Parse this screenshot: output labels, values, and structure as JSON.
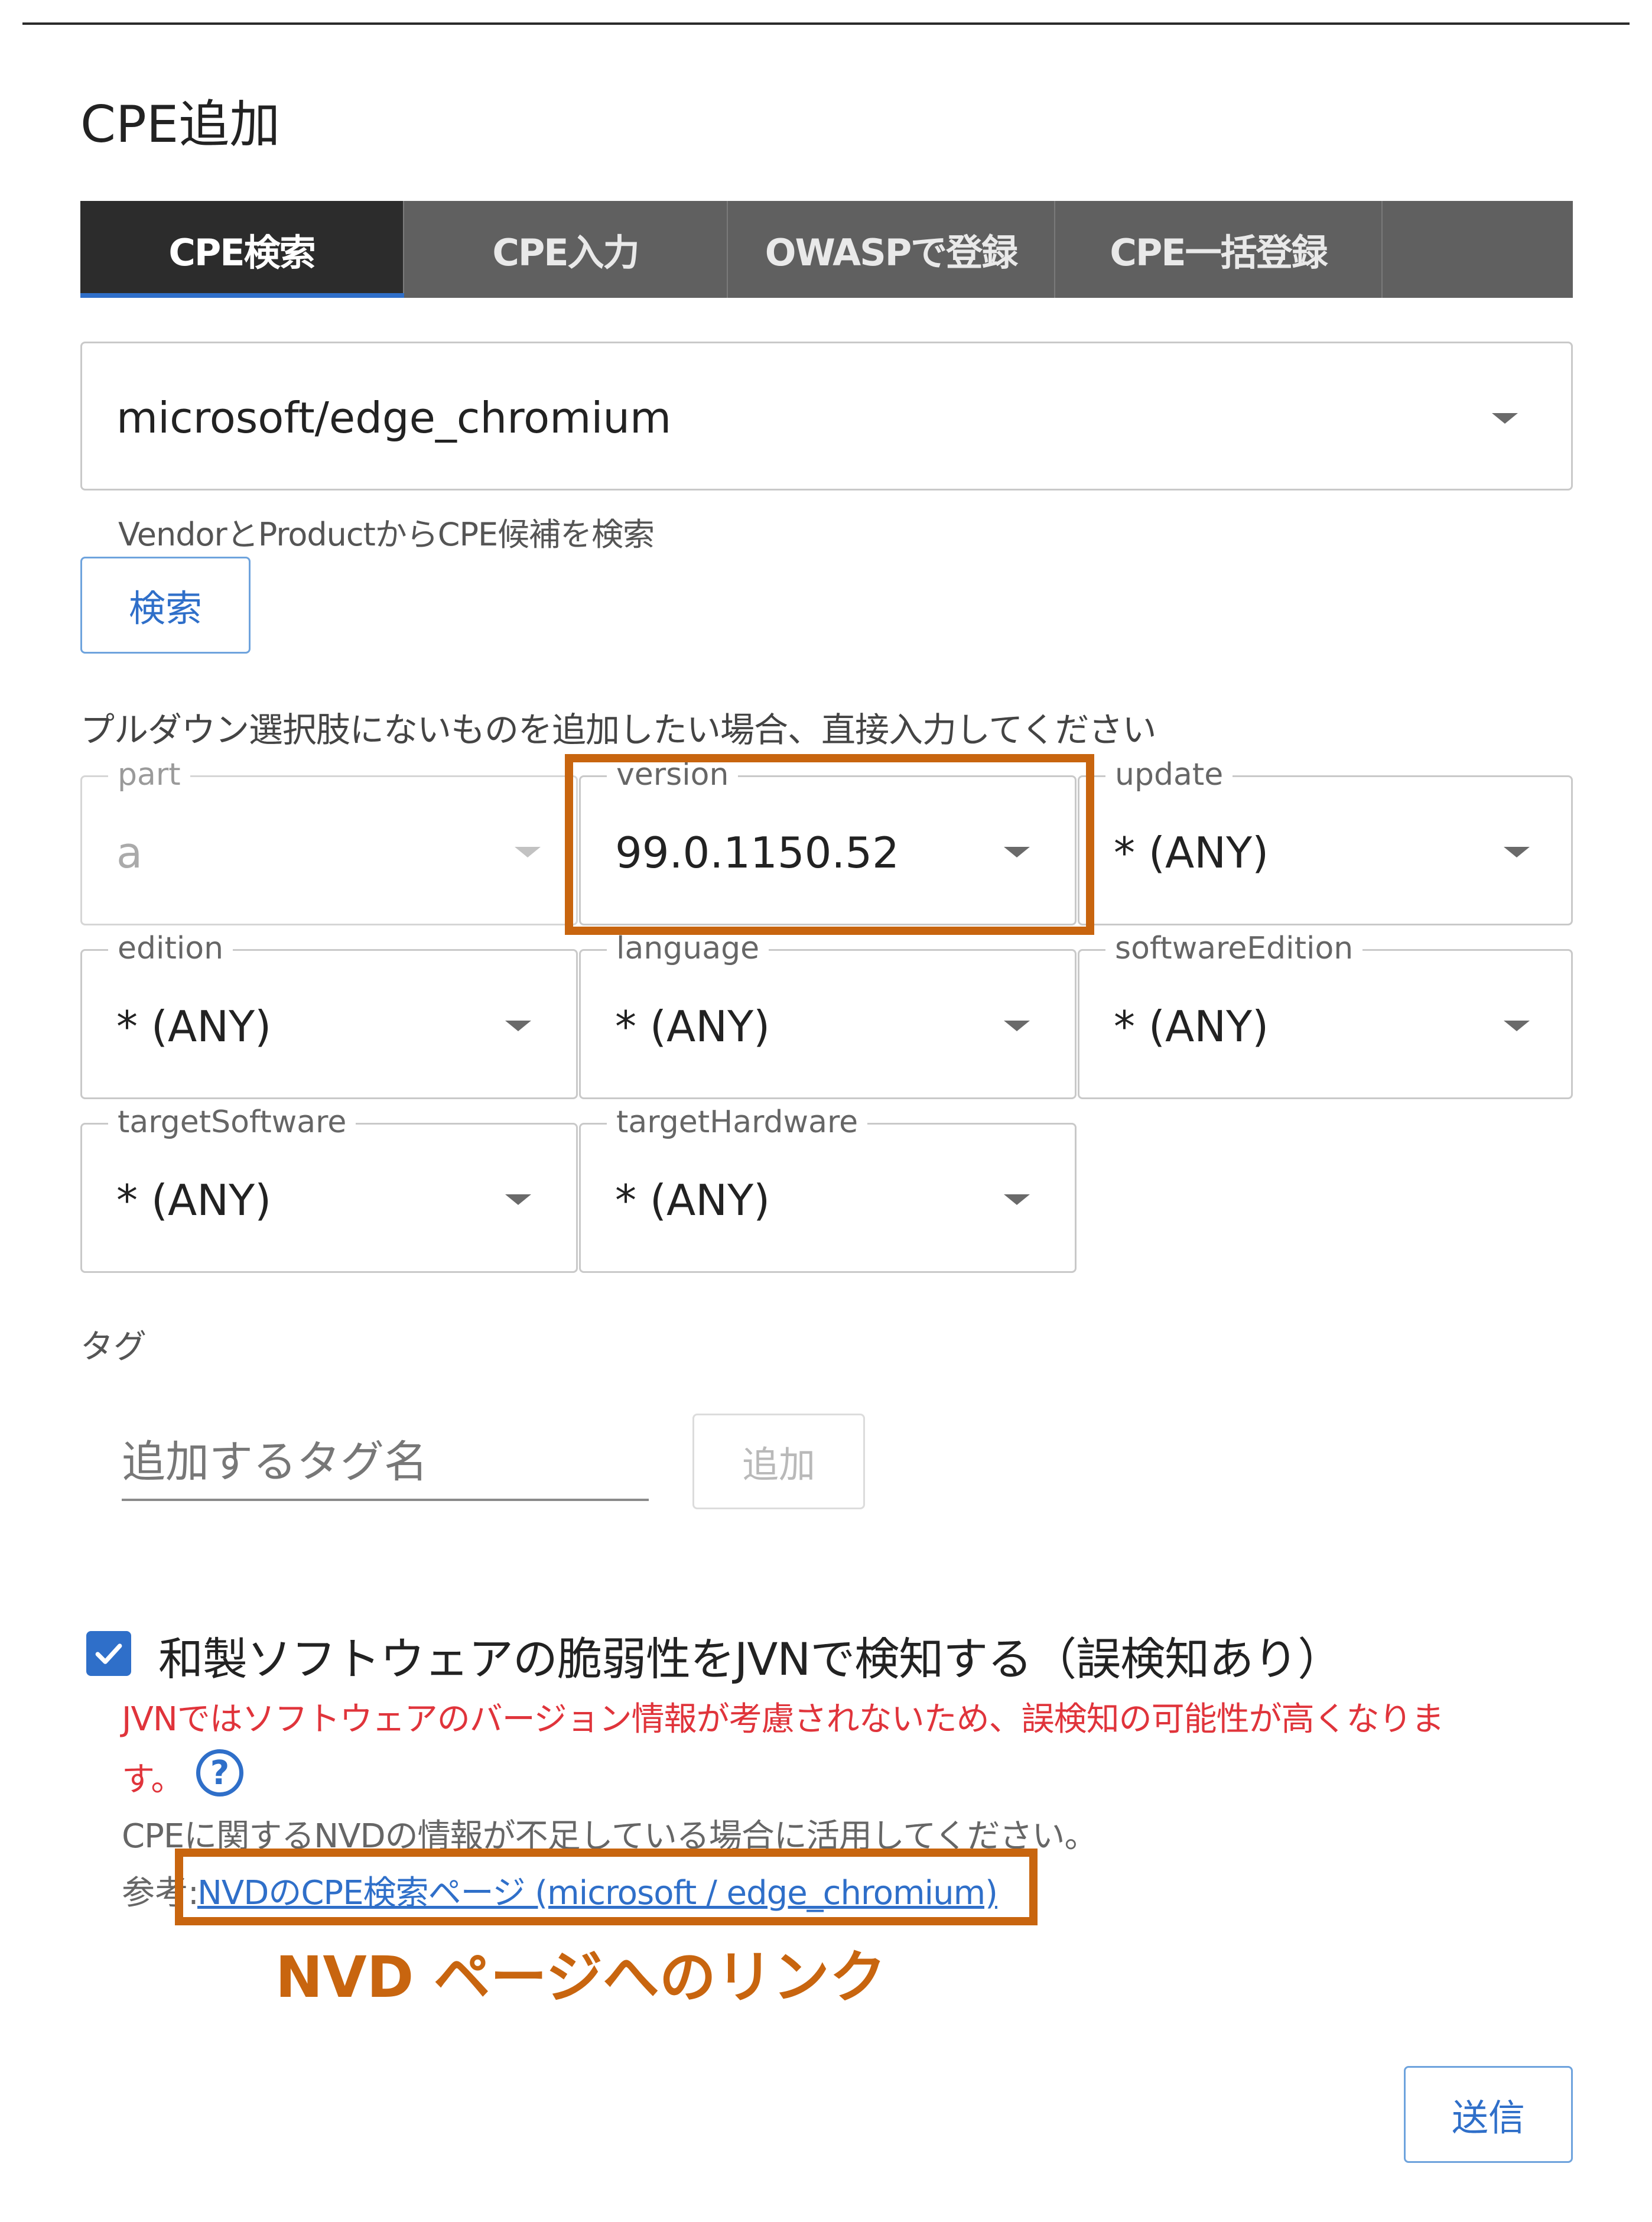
{
  "dialog": {
    "title": "CPE追加"
  },
  "tabs": [
    {
      "label": "CPE検索",
      "active": true
    },
    {
      "label": "CPE入力",
      "active": false
    },
    {
      "label": "OWASPで登録",
      "active": false
    },
    {
      "label": "CPE一括登録",
      "active": false
    }
  ],
  "search": {
    "selected_value": "microsoft/edge_chromium",
    "helper": "VendorとProductからCPE候補を検索",
    "button": "検索"
  },
  "instruction": "プルダウン選択肢にないものを追加したい場合、直接入力してください",
  "fields": {
    "part": {
      "label": "part",
      "value": "a",
      "disabled": true
    },
    "version": {
      "label": "version",
      "value": "99.0.1150.52"
    },
    "update": {
      "label": "update",
      "value": "* (ANY)"
    },
    "edition": {
      "label": "edition",
      "value": "* (ANY)"
    },
    "language": {
      "label": "language",
      "value": "* (ANY)"
    },
    "softwareEdition": {
      "label": "softwareEdition",
      "value": "* (ANY)"
    },
    "targetSoftware": {
      "label": "targetSoftware",
      "value": "* (ANY)"
    },
    "targetHardware": {
      "label": "targetHardware",
      "value": "* (ANY)"
    }
  },
  "tags": {
    "heading": "タグ",
    "placeholder": "追加するタグ名",
    "add_button": "追加"
  },
  "jvn": {
    "checked": true,
    "label": "和製ソフトウェアの脆弱性をJVNで検知する（誤検知あり）",
    "warning_line1": "JVNではソフトウェアのバージョン情報が考慮されないため、誤検知の可能性が高くなりま",
    "warning_line2": "す。",
    "help_icon": "?",
    "note": "CPEに関するNVDの情報が不足している場合に活用してください。",
    "ref_prefix": "参考:",
    "ref_link": "NVDのCPE検索ページ (microsoft / edge_chromium)"
  },
  "annotation": {
    "text": "NVD ページへのリンク",
    "color": "#c8650f"
  },
  "submit": {
    "label": "送信"
  },
  "colors": {
    "accent": "#2f6fc9",
    "warning": "#e0343b",
    "highlight": "#c8650f",
    "tab_active": "#2c2c2c",
    "tab_bg": "#606060"
  }
}
